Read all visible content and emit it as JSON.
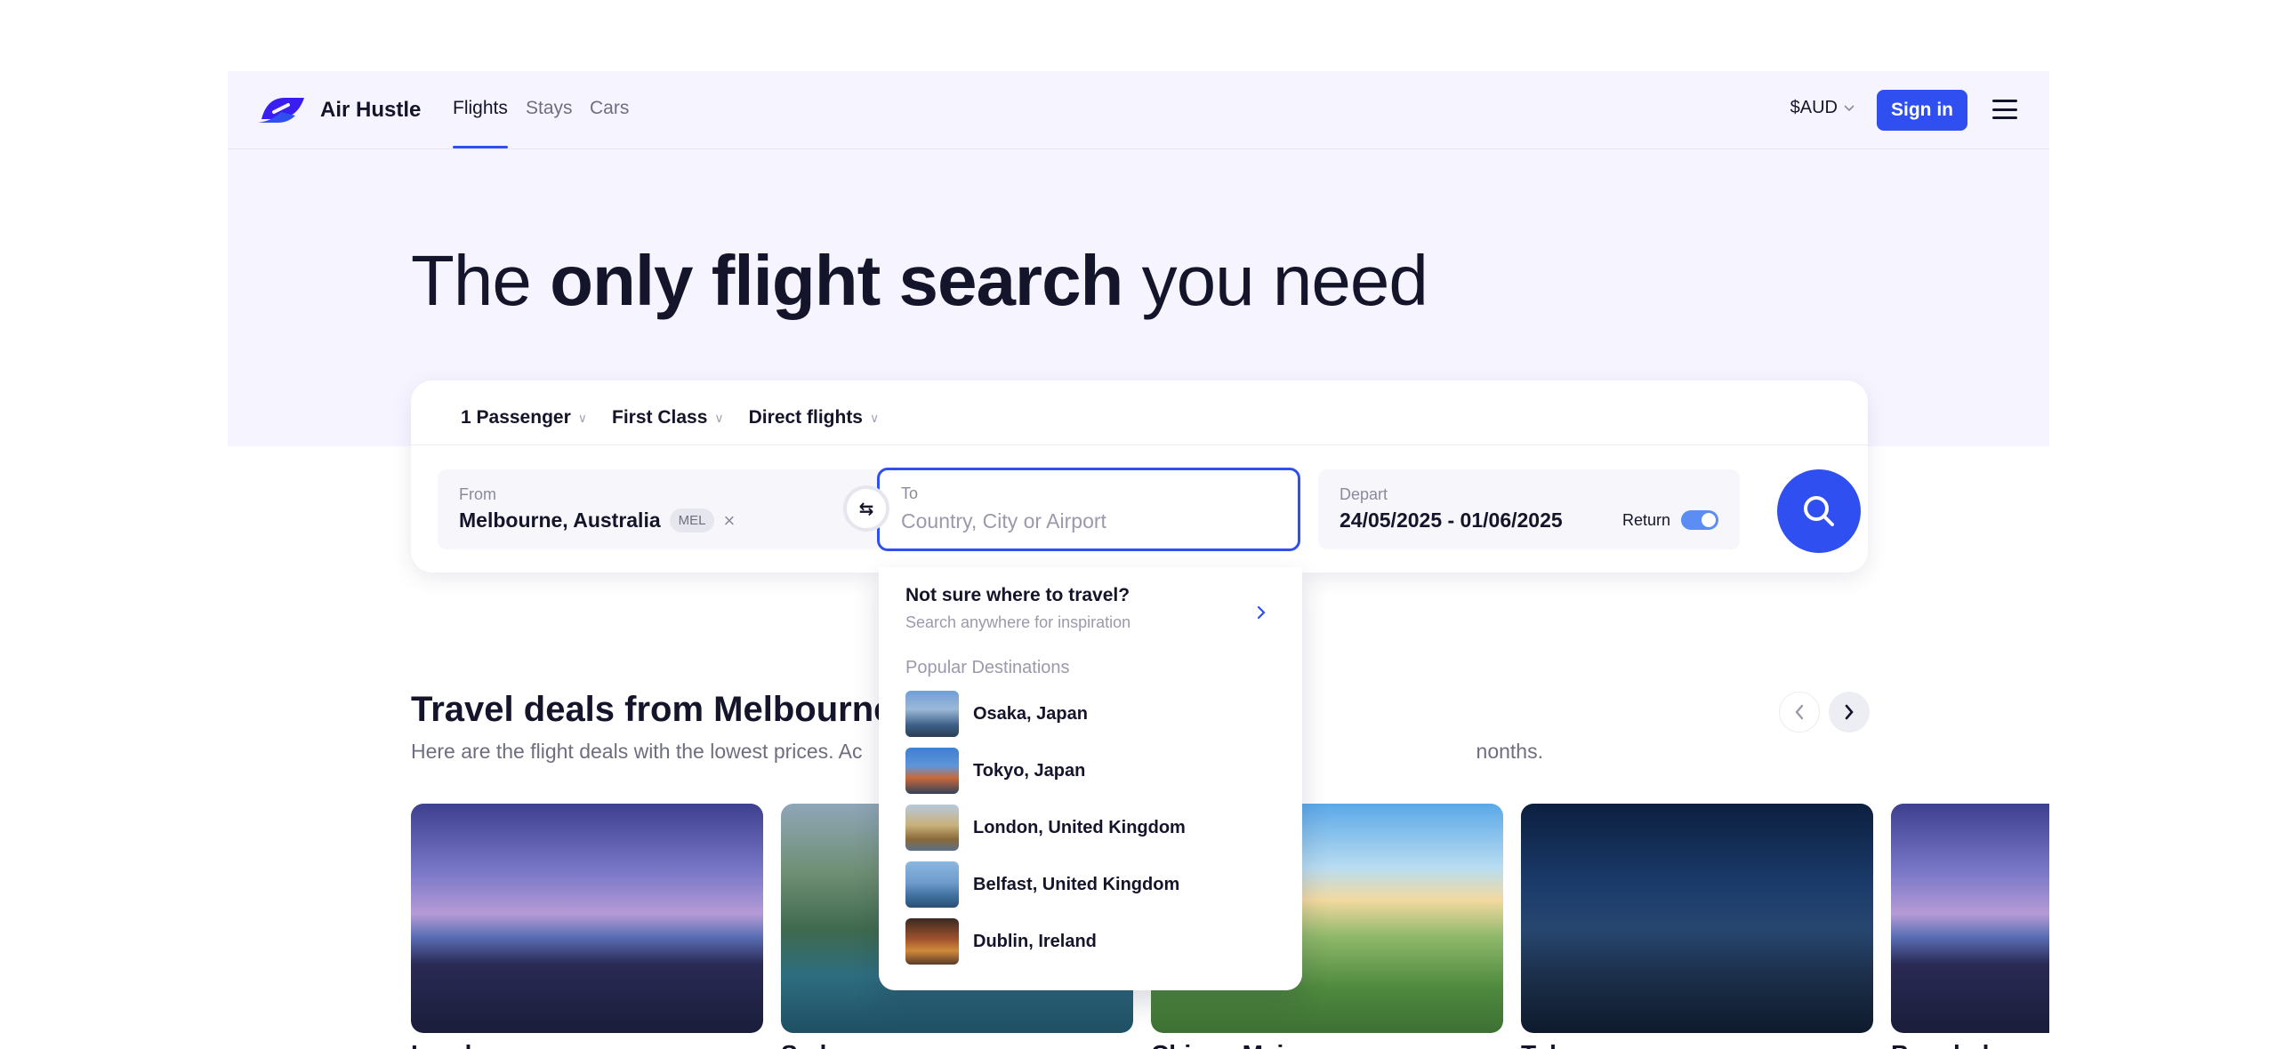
{
  "header": {
    "brand": "Air Hustle",
    "nav": [
      {
        "label": "Flights",
        "active": true
      },
      {
        "label": "Stays",
        "active": false
      },
      {
        "label": "Cars",
        "active": false
      }
    ],
    "currency": "$AUD",
    "signin_label": "Sign in",
    "accent_color": "#2f4ff0"
  },
  "hero": {
    "headline_pre": "The ",
    "headline_bold": "only flight search",
    "headline_post": " you need"
  },
  "search": {
    "passengers": "1 Passenger",
    "cabin": "First Class",
    "stops": "Direct flights",
    "from_label": "From",
    "from_value": "Melbourne, Australia",
    "from_code": "MEL",
    "to_label": "To",
    "to_placeholder": "Country, City or Airport",
    "to_value": "",
    "depart_label": "Depart",
    "dates": "24/05/2025 - 01/06/2025",
    "return_label": "Return",
    "return_enabled": true
  },
  "dropdown": {
    "inspire_title": "Not sure where to travel?",
    "inspire_sub": "Search anywhere for inspiration",
    "section_label": "Popular Destinations",
    "destinations": [
      {
        "label": "Osaka, Japan"
      },
      {
        "label": "Tokyo, Japan"
      },
      {
        "label": "London, United Kingdom"
      },
      {
        "label": "Belfast, United Kingdom"
      },
      {
        "label": "Dublin, Ireland"
      }
    ]
  },
  "deals": {
    "title": "Travel deals from Melbourne",
    "subtitle_start": "Here are the flight deals with the lowest prices. Ac",
    "subtitle_end": "nonths.",
    "cards": [
      {
        "name": "London"
      },
      {
        "name": "Sydney"
      },
      {
        "name": "Chiang Mai"
      },
      {
        "name": "Tokyo"
      },
      {
        "name": "Bangkok"
      }
    ]
  }
}
